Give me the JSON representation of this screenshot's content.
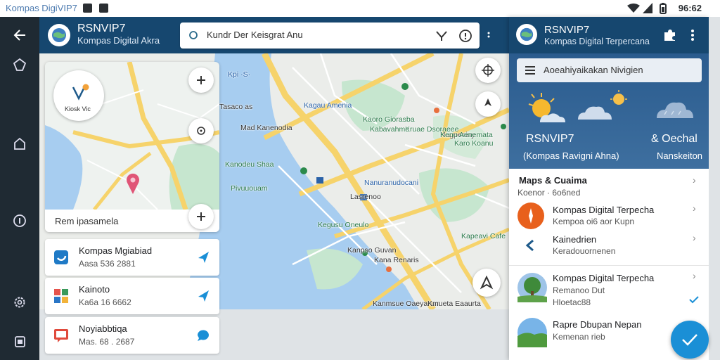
{
  "status_bar": {
    "app_title": "Kompas DigiVIP7",
    "clock": "96:62"
  },
  "header": {
    "title": "RSNVIP7",
    "subtitle": "Kompas Digital Akra"
  },
  "search": {
    "query": "Kundr Der Keisgrat Anu"
  },
  "map": {
    "labels": [
      {
        "text": "Kpi ·S·"
      },
      {
        "text": "Tasaco as"
      },
      {
        "text": "Kagau Amenia"
      },
      {
        "text": "Kaoro Giorasba"
      },
      {
        "text": "Kruae Dsoraeee"
      },
      {
        "text": "Mad Kanenodia"
      },
      {
        "text": "Kabavahme"
      },
      {
        "text": "Nagpesiny"
      },
      {
        "text": "Kenu Aenemata"
      },
      {
        "text": "Karo Koanu"
      },
      {
        "text": "Kanodeu Shaa"
      },
      {
        "text": "Pivuuouam"
      },
      {
        "text": "Nanuranudocani"
      },
      {
        "text": "Lasrenoo"
      },
      {
        "text": "Kegusu Oneulo"
      },
      {
        "text": "Kanpso Guvan"
      },
      {
        "text": "Kana Renaris"
      },
      {
        "text": "Kapeavi Cafe"
      },
      {
        "text": "Kanmsue Oaeyarum"
      },
      {
        "text": "Kmueta Eaaurta"
      }
    ]
  },
  "inset": {
    "badge_label": "Kiosk Vic",
    "footer_text": "Rem ipasamela"
  },
  "left_cards": [
    {
      "name": "Kompas Mgiabiad",
      "sub": "Aasa 536 2881"
    },
    {
      "name": "Kainoto",
      "sub": "Ka6a 16 6662"
    },
    {
      "name": "Noyiabbtiqa",
      "sub": "Mas. 68 . 2687"
    }
  ],
  "right_panel": {
    "header_title": "RSNVIP7",
    "header_subtitle": "Kompas Digital Terpercana",
    "weather_search": "Aoeahiyaikakan Nivigien",
    "weather_left_title": "RSNVIP7",
    "weather_left_sub": "(Kompas Ravigni Ahna)",
    "weather_right_title": "& Oechal",
    "weather_right_sub": "Nanskeiton",
    "section_title": "Maps & Cuaima",
    "section_sub": "Koenor · 6o6ned",
    "items": [
      {
        "name": "Kompas Digital Terpecha",
        "sub": "Kempoa oi6 aor Kupn"
      },
      {
        "name": "Kainedrien",
        "sub": "Keradouornenen"
      },
      {
        "name": "Kompas Digital Terpecha",
        "sub": "Remanoo Dut",
        "sub2": "Hloetac88"
      },
      {
        "name": "Rapre Dbupan Nepan",
        "sub": "Kemenan rieb"
      }
    ]
  },
  "colors": {
    "header_bg": "#16476f",
    "water": "#a7cdf0",
    "road": "#f6d36b",
    "park": "#c6e6cf",
    "accent": "#1a8fd6",
    "pin": "#e05577"
  }
}
